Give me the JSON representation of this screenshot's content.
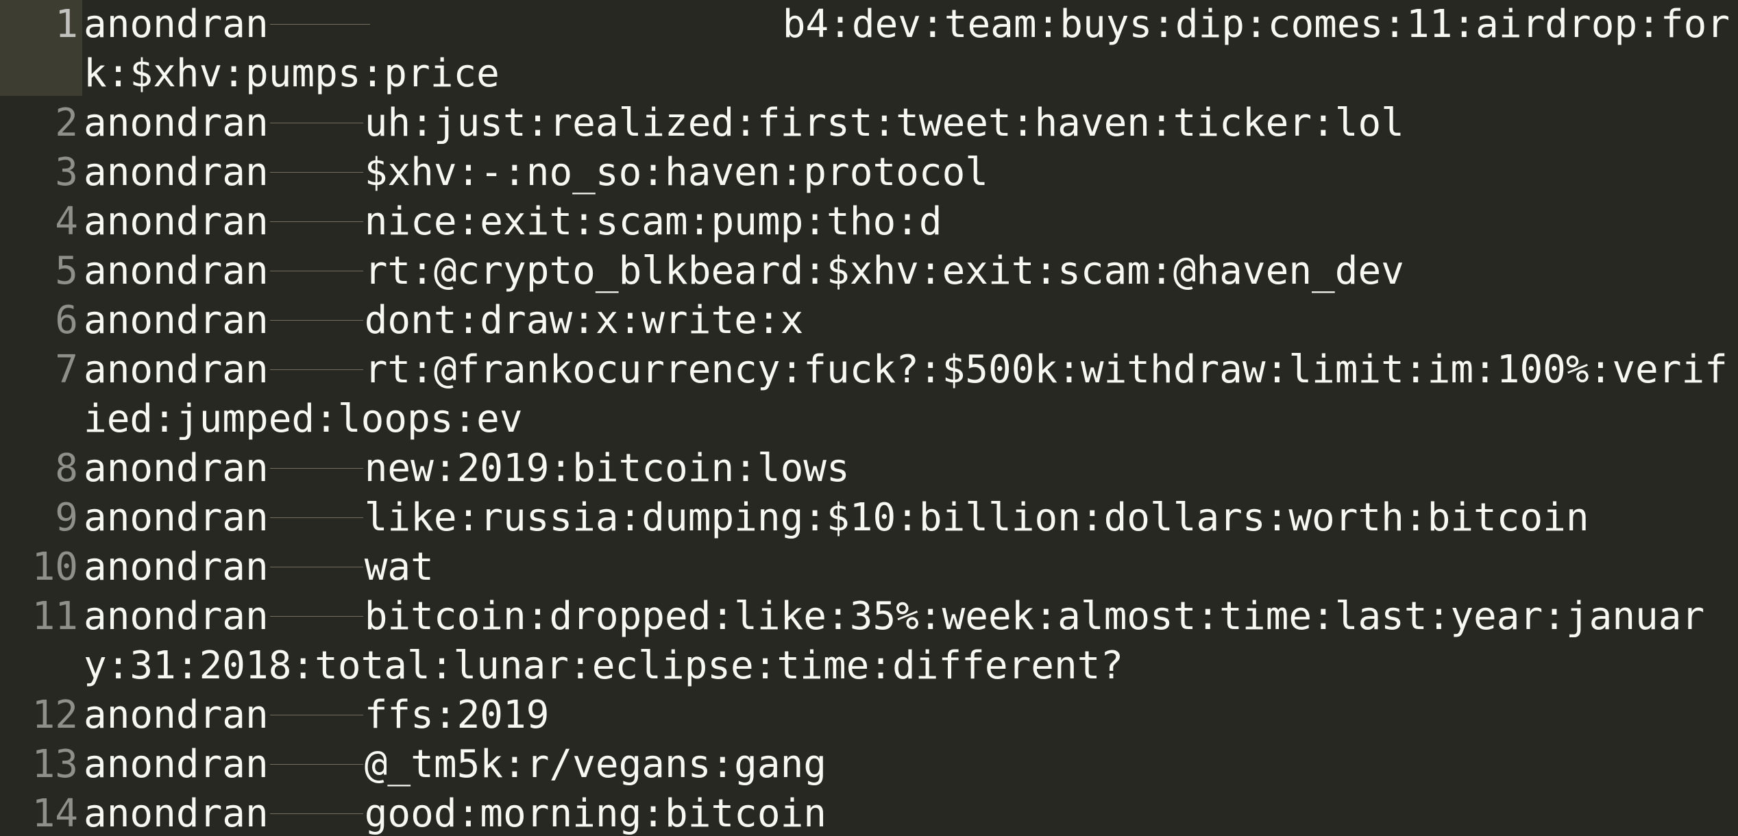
{
  "editor": {
    "colors": {
      "background": "#272822",
      "text": "#f8f8f2",
      "gutter_text": "#90908a",
      "active_line": "#3e3d32",
      "tab_arrow": "#75715e"
    },
    "active_line_number": "1",
    "lines": [
      {
        "number": "1",
        "user": "anondran",
        "text": "b4:dev:team:buys:dip:comes:11:airdrop:fork:$xhv:pumps:price"
      },
      {
        "number": "2",
        "user": "anondran",
        "text": "uh:just:realized:first:tweet:haven:ticker:lol"
      },
      {
        "number": "3",
        "user": "anondran",
        "text": "$xhv:-:no_so:haven:protocol"
      },
      {
        "number": "4",
        "user": "anondran",
        "text": "nice:exit:scam:pump:tho:d"
      },
      {
        "number": "5",
        "user": "anondran",
        "text": "rt:@crypto_blkbeard:$xhv:exit:scam:@haven_dev"
      },
      {
        "number": "6",
        "user": "anondran",
        "text": "dont:draw:x:write:x"
      },
      {
        "number": "7",
        "user": "anondran",
        "text": "rt:@frankocurrency:fuck?:$500k:withdraw:limit:im:100%:verified:jumped:loops:ev"
      },
      {
        "number": "8",
        "user": "anondran",
        "text": "new:2019:bitcoin:lows"
      },
      {
        "number": "9",
        "user": "anondran",
        "text": "like:russia:dumping:$10:billion:dollars:worth:bitcoin"
      },
      {
        "number": "10",
        "user": "anondran",
        "text": "wat"
      },
      {
        "number": "11",
        "user": "anondran",
        "text": "bitcoin:dropped:like:35%:week:almost:time:last:year:january:31:2018:total:lunar:eclipse:time:different?"
      },
      {
        "number": "12",
        "user": "anondran",
        "text": "ffs:2019"
      },
      {
        "number": "13",
        "user": "anondran",
        "text": "@_tm5k:r/vegans:gang"
      },
      {
        "number": "14",
        "user": "anondran",
        "text": "good:morning:bitcoin"
      }
    ]
  }
}
